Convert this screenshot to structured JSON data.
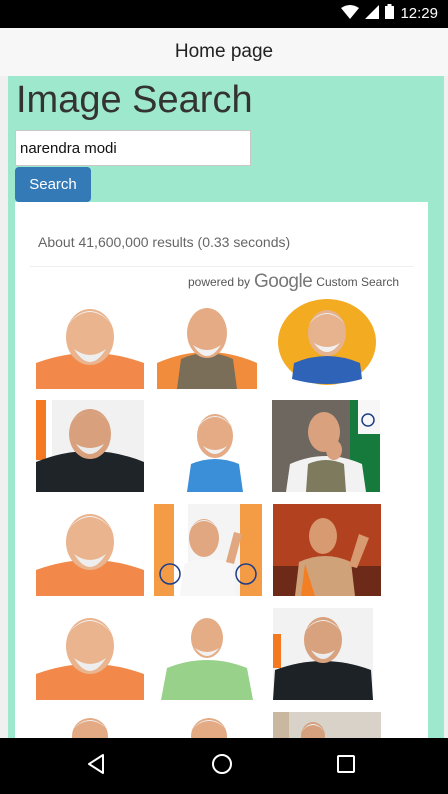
{
  "status_bar": {
    "time": "12:29",
    "icons": [
      "wifi-icon",
      "signal-icon",
      "battery-icon"
    ]
  },
  "app_bar": {
    "title": "Home page"
  },
  "page": {
    "heading": "Image Search"
  },
  "search": {
    "value": "narendra modi",
    "button_label": "Search"
  },
  "results": {
    "count_text": "About 41,600,000 results (0.33 seconds)",
    "powered_by": "powered by",
    "google_logo": "Google",
    "custom_search": "Custom Search"
  },
  "nav": {
    "buttons": [
      "back-icon",
      "home-icon",
      "recents-icon"
    ]
  },
  "colors": {
    "page_bg": "#9ee8cd",
    "button": "#337ab7",
    "status_bar": "#000000"
  }
}
